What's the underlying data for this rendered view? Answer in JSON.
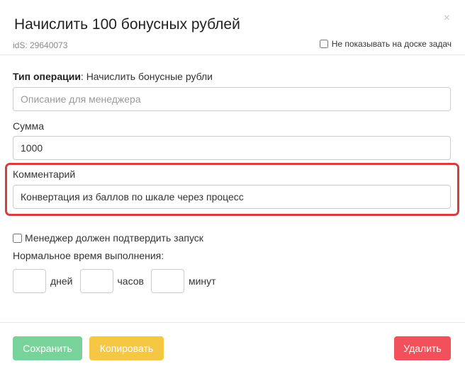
{
  "modal": {
    "title": "Начислить 100 бонусных рублей",
    "ids": "idS: 29640073",
    "close_glyph": "×",
    "hide_board_label": "Не показывать на доске задач",
    "hide_board_checked": false
  },
  "form": {
    "operation_type_label": "Тип операции",
    "operation_type_value": ": Начислить бонусные рубли",
    "description_placeholder": "Описание для менеджера",
    "description_value": "",
    "sum_label": "Сумма",
    "sum_value": "1000",
    "comment_label": "Комментарий",
    "comment_value": "Конвертация из баллов по шкале через процесс",
    "comment_highlight_color": "#dc3c3c",
    "confirm_label": "Менеджер должен подтвердить запуск",
    "confirm_checked": false,
    "time_label": "Нормальное время выполнения:",
    "days_value": "",
    "days_unit": "дней",
    "hours_value": "",
    "hours_unit": "часов",
    "minutes_value": "",
    "minutes_unit": "минут"
  },
  "buttons": {
    "save": "Сохранить",
    "copy": "Копировать",
    "delete": "Удалить"
  },
  "colors": {
    "save": "#78d39a",
    "copy": "#f5c743",
    "delete": "#f2505a"
  }
}
